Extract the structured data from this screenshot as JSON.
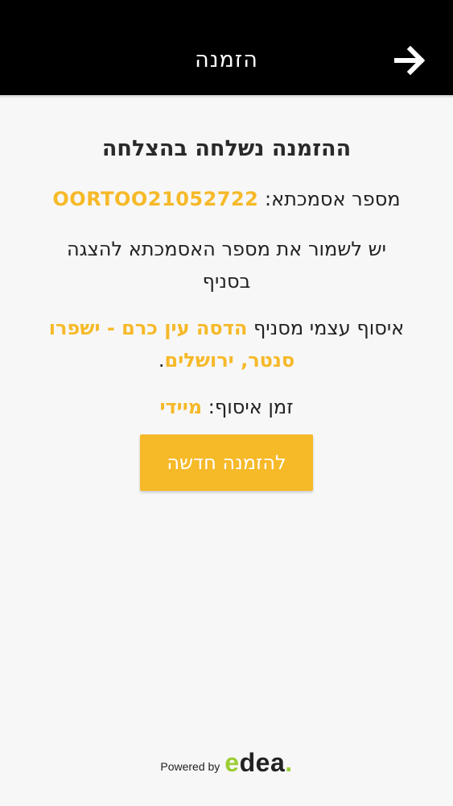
{
  "header": {
    "title": "הזמנה",
    "back_icon": "arrow-right-icon"
  },
  "main": {
    "success_title": "ההזמנה נשלחה בהצלחה",
    "ref_label": "מספר אסמכתא: ",
    "ref_number": "OORTOO21052722",
    "save_notice": "יש לשמור את מספר האסמכתא להצגה בסניף",
    "pickup_prefix": "איסוף עצמי מסניף ",
    "branch_name": "הדסה עין כרם - ישפרו סנטר, ירושלים",
    "pickup_suffix": ".",
    "pickup_time_label": "זמן איסוף: ",
    "pickup_time_value": "מיידי"
  },
  "actions": {
    "new_order_label": "להזמנה חדשה"
  },
  "footer": {
    "powered_by": "Powered by",
    "brand_e": "e",
    "brand_rest": "dea",
    "brand_dot": "."
  },
  "colors": {
    "accent": "#f6b928",
    "header_bg": "#000000",
    "brand_green": "#9acd32"
  }
}
